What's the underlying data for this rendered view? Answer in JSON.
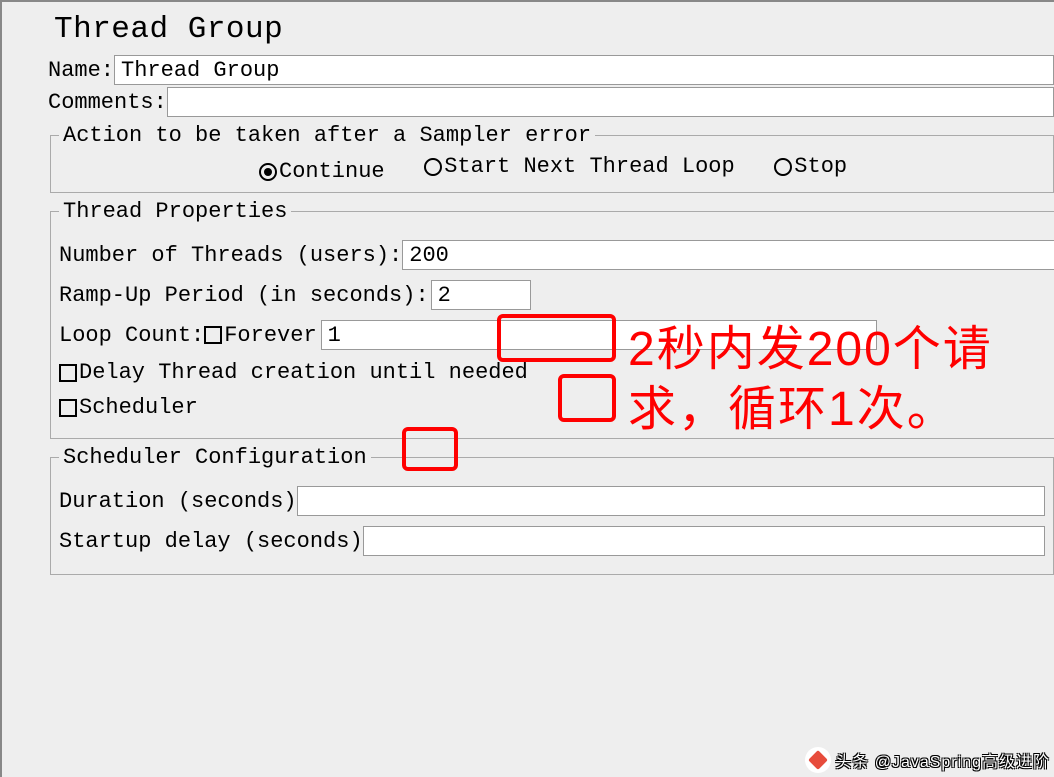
{
  "title": "Thread Group",
  "name": {
    "label": "Name:",
    "value": "Thread Group"
  },
  "comments": {
    "label": "Comments:",
    "value": ""
  },
  "error_action": {
    "legend": "Action to be taken after a Sampler error",
    "options": {
      "continue": "Continue",
      "start_next": "Start Next Thread Loop",
      "stop": "Stop"
    },
    "selected": "continue"
  },
  "thread_props": {
    "legend": "Thread Properties",
    "num_threads_label": "Number of Threads (users):",
    "num_threads_value": "200",
    "rampup_label": "Ramp-Up Period (in seconds):",
    "rampup_value": "2",
    "loop_count_label": "Loop Count:",
    "forever_label": "Forever",
    "loop_count_value": "1",
    "delay_creation_label": "Delay Thread creation until needed",
    "scheduler_label": "Scheduler"
  },
  "scheduler": {
    "legend": "Scheduler Configuration",
    "duration_label": "Duration (seconds)",
    "duration_value": "",
    "startup_delay_label": "Startup delay (seconds)",
    "startup_delay_value": ""
  },
  "annotation_text": "2秒内发200个请求，循环1次。",
  "watermark": "头条 @JavaSpring高级进阶"
}
